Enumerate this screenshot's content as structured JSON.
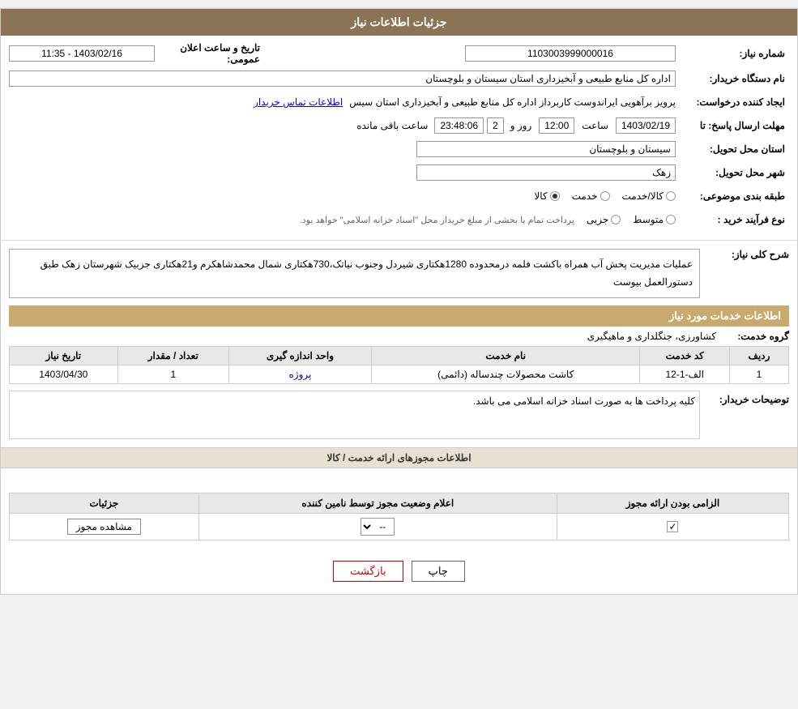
{
  "page": {
    "title": "جزئیات اطلاعات نیاز"
  },
  "header": {
    "shomara_niaz_label": "شماره نیاز:",
    "shomara_niaz_value": "1103003999000016",
    "nam_dastgah_label": "نام دستگاه خریدار:",
    "nam_dastgah_value": "اداره کل منابع طبیعی و آبخیزداری استان سیستان و بلوچستان",
    "tarikh_label": "تاریخ و ساعت اعلان عمومی:",
    "tarikh_value": "1403/02/16 - 11:35",
    "ijad_label": "ایجاد کننده درخواست:",
    "ijad_value": "پرویز برآهویی ایراندوست کاربرداز اداره کل منابع طبیعی و آبخیزداری استان سیس",
    "ettelaat_tamas": "اطلاعات تماس خریدار",
    "mohlat_label": "مهلت ارسال پاسخ: تا",
    "mohlat_date": "1403/02/19",
    "mohlat_time": "12:00",
    "mohlat_day_label": "روز و",
    "mohlat_days": "2",
    "mohlat_time_remain": "23:48:06",
    "mohlat_remain_label": "ساعت باقی مانده",
    "ostan_label": "استان محل تحویل:",
    "ostan_value": "سیستان و بلوچستان",
    "shahr_label": "شهر محل تحویل:",
    "shahr_value": "زهک",
    "tabaqe_label": "طبقه بندی موضوعی:",
    "tabaqe_options": [
      "کالا",
      "خدمت",
      "کالا/خدمت"
    ],
    "tabaqe_selected": "کالا",
    "nooe_farayand_label": "نوع فرآیند خرید :",
    "nooe_options": [
      "جزیی",
      "متوسط"
    ],
    "nooe_note": "پرداخت تمام یا بخشی از مبلغ خریداز محل \"اسناد خزانه اسلامی\" خواهد بود."
  },
  "sharh": {
    "section_title": "شرح کلی نیاز:",
    "content": "عملیات مدیریت پخش آب همراه باکشت فلمه درمحدوده 1280هکتاری شیردل وجنوب نیاتک،730هکتاری شمال محمدشاهکرم و21هکتاری جزبیک شهرستان زهک طبق دستورالعمل بیوست"
  },
  "khadamat": {
    "section_title": "اطلاعات خدمات مورد نیاز",
    "gorooh_label": "گروه خدمت:",
    "gorooh_value": "کشاورزی، جنگلداری و ماهیگیری",
    "table": {
      "headers": [
        "ردیف",
        "کد خدمت",
        "نام خدمت",
        "واحد اندازه گیری",
        "تعداد / مقدار",
        "تاریخ نیاز"
      ],
      "rows": [
        {
          "radif": "1",
          "kod": "الف-1-12",
          "name": "کاشت محصولات چندساله (دائمی)",
          "vahed": "پروژه",
          "tedad": "1",
          "tarikh": "1403/04/30"
        }
      ]
    },
    "note": "کلیه پرداخت ها به صورت اسناد خزانه اسلامی می باشد."
  },
  "mojozha": {
    "section_title": "اطلاعات مجوزهای ارائه خدمت / کالا",
    "table": {
      "headers": [
        "الزامی بودن ارائه مجوز",
        "اعلام وضعیت مجوز توسط نامین کننده",
        "جزئیات"
      ],
      "rows": [
        {
          "elzami": "checked",
          "alam": "--",
          "joziyat": "مشاهده مجوز"
        }
      ]
    }
  },
  "buttons": {
    "print": "چاپ",
    "back": "بازگشت"
  }
}
